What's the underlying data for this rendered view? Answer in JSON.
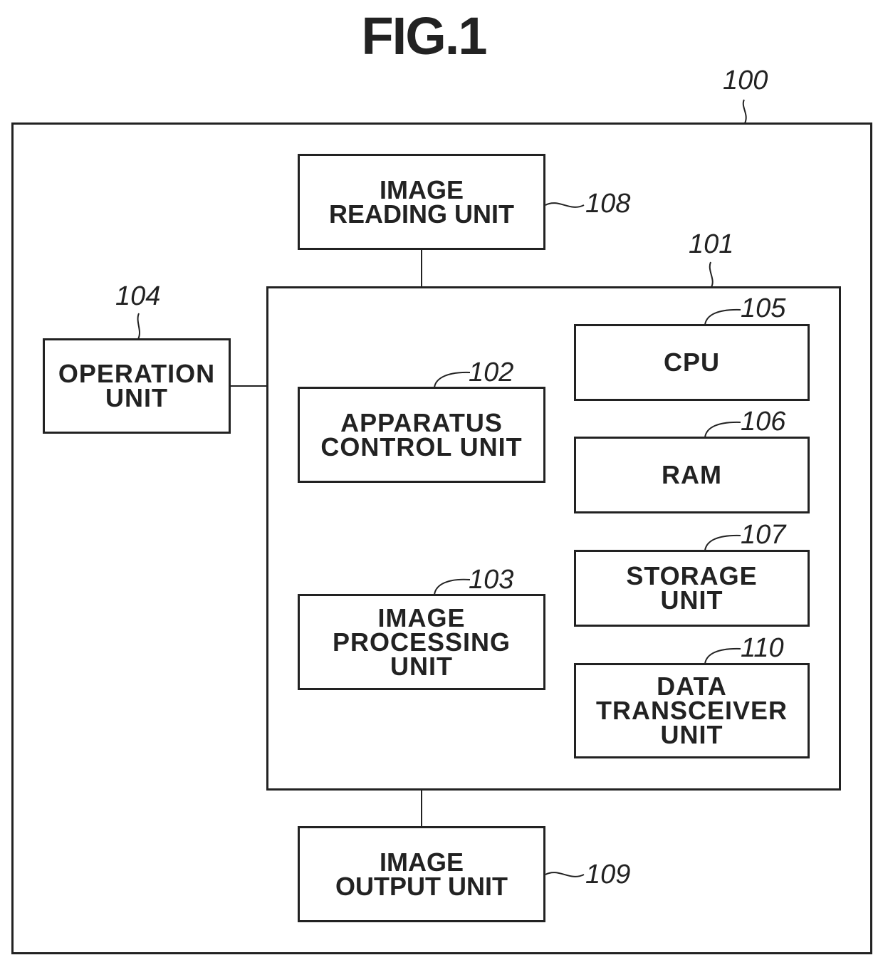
{
  "figure": {
    "title": "FIG.1",
    "apparatus_ref": "100",
    "controller_ref": "101"
  },
  "blocks": {
    "image_reading": {
      "label": "IMAGE\nREADING UNIT",
      "ref": "108"
    },
    "operation": {
      "label": "OPERATION\nUNIT",
      "ref": "104"
    },
    "apparatus_control": {
      "label": "APPARATUS\nCONTROL UNIT",
      "ref": "102"
    },
    "image_processing": {
      "label": "IMAGE\nPROCESSING\nUNIT",
      "ref": "103"
    },
    "cpu": {
      "label": "CPU",
      "ref": "105"
    },
    "ram": {
      "label": "RAM",
      "ref": "106"
    },
    "storage": {
      "label": "STORAGE\nUNIT",
      "ref": "107"
    },
    "data_transceiver": {
      "label": "DATA\nTRANSCEIVER\nUNIT",
      "ref": "110"
    },
    "image_output": {
      "label": "IMAGE\nOUTPUT UNIT",
      "ref": "109"
    }
  },
  "connections": [
    [
      "image_reading",
      "controller"
    ],
    [
      "operation",
      "controller"
    ],
    [
      "controller",
      "image_output"
    ]
  ]
}
